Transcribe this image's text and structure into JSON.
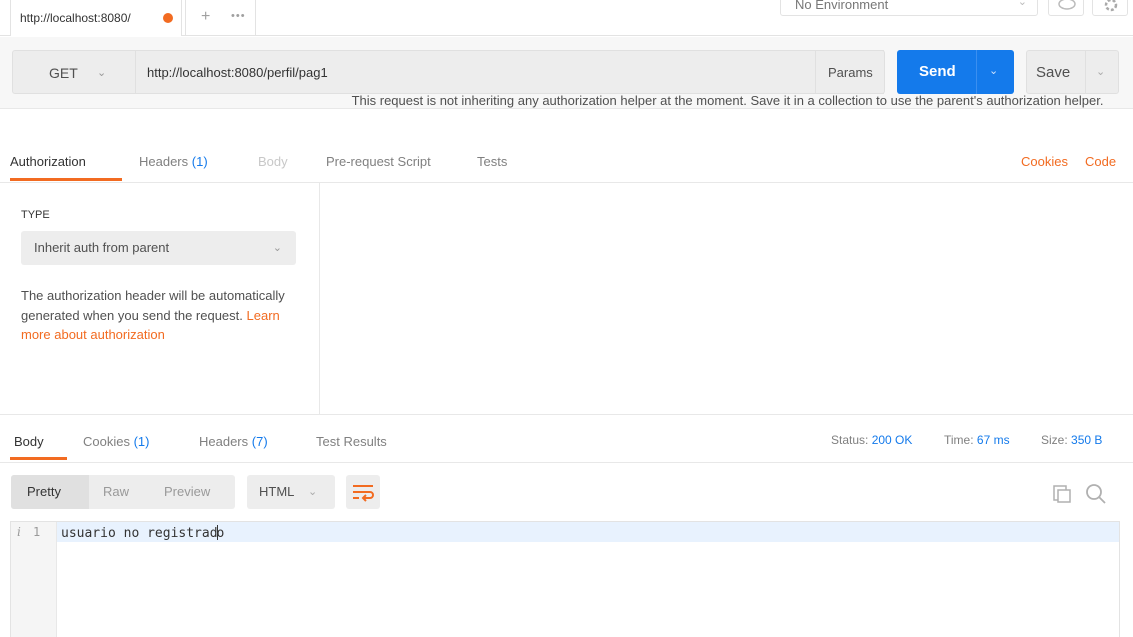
{
  "tab": {
    "label": "http://localhost:8080/",
    "plus": "+",
    "more": "•••"
  },
  "environment": {
    "label": "No Environment"
  },
  "request": {
    "method": "GET",
    "url": "http://localhost:8080/perfil/pag1",
    "params_label": "Params",
    "send_label": "Send",
    "save_label": "Save"
  },
  "request_tabs": {
    "authorization": "Authorization",
    "headers": "Headers",
    "headers_count": "(1)",
    "body": "Body",
    "prerequest": "Pre-request Script",
    "tests": "Tests",
    "cookies": "Cookies",
    "code": "Code"
  },
  "auth": {
    "type_label": "TYPE",
    "type_value": "Inherit auth from parent",
    "desc_prefix": "The authorization header will be automatically generated when you send the request. ",
    "desc_link": "Learn more about authorization",
    "message": "This request is not inheriting any authorization helper at the moment. Save it in a collection to use the parent's authorization helper."
  },
  "response_tabs": {
    "body": "Body",
    "cookies": "Cookies",
    "cookies_count": "(1)",
    "headers": "Headers",
    "headers_count": "(7)",
    "test_results": "Test Results",
    "status_label": "Status:",
    "status_value": "200 OK",
    "time_label": "Time:",
    "time_value": "67 ms",
    "size_label": "Size:",
    "size_value": "350 B"
  },
  "response_toolbar": {
    "pretty": "Pretty",
    "raw": "Raw",
    "preview": "Preview",
    "format": "HTML"
  },
  "editor": {
    "info_marker": "i",
    "line_number": "1",
    "code_before_cursor": "usuario no registrad",
    "code_after_cursor": "o"
  },
  "colors": {
    "accent": "#f26b21",
    "send": "#147aeb",
    "link_blue": "#147aeb"
  }
}
